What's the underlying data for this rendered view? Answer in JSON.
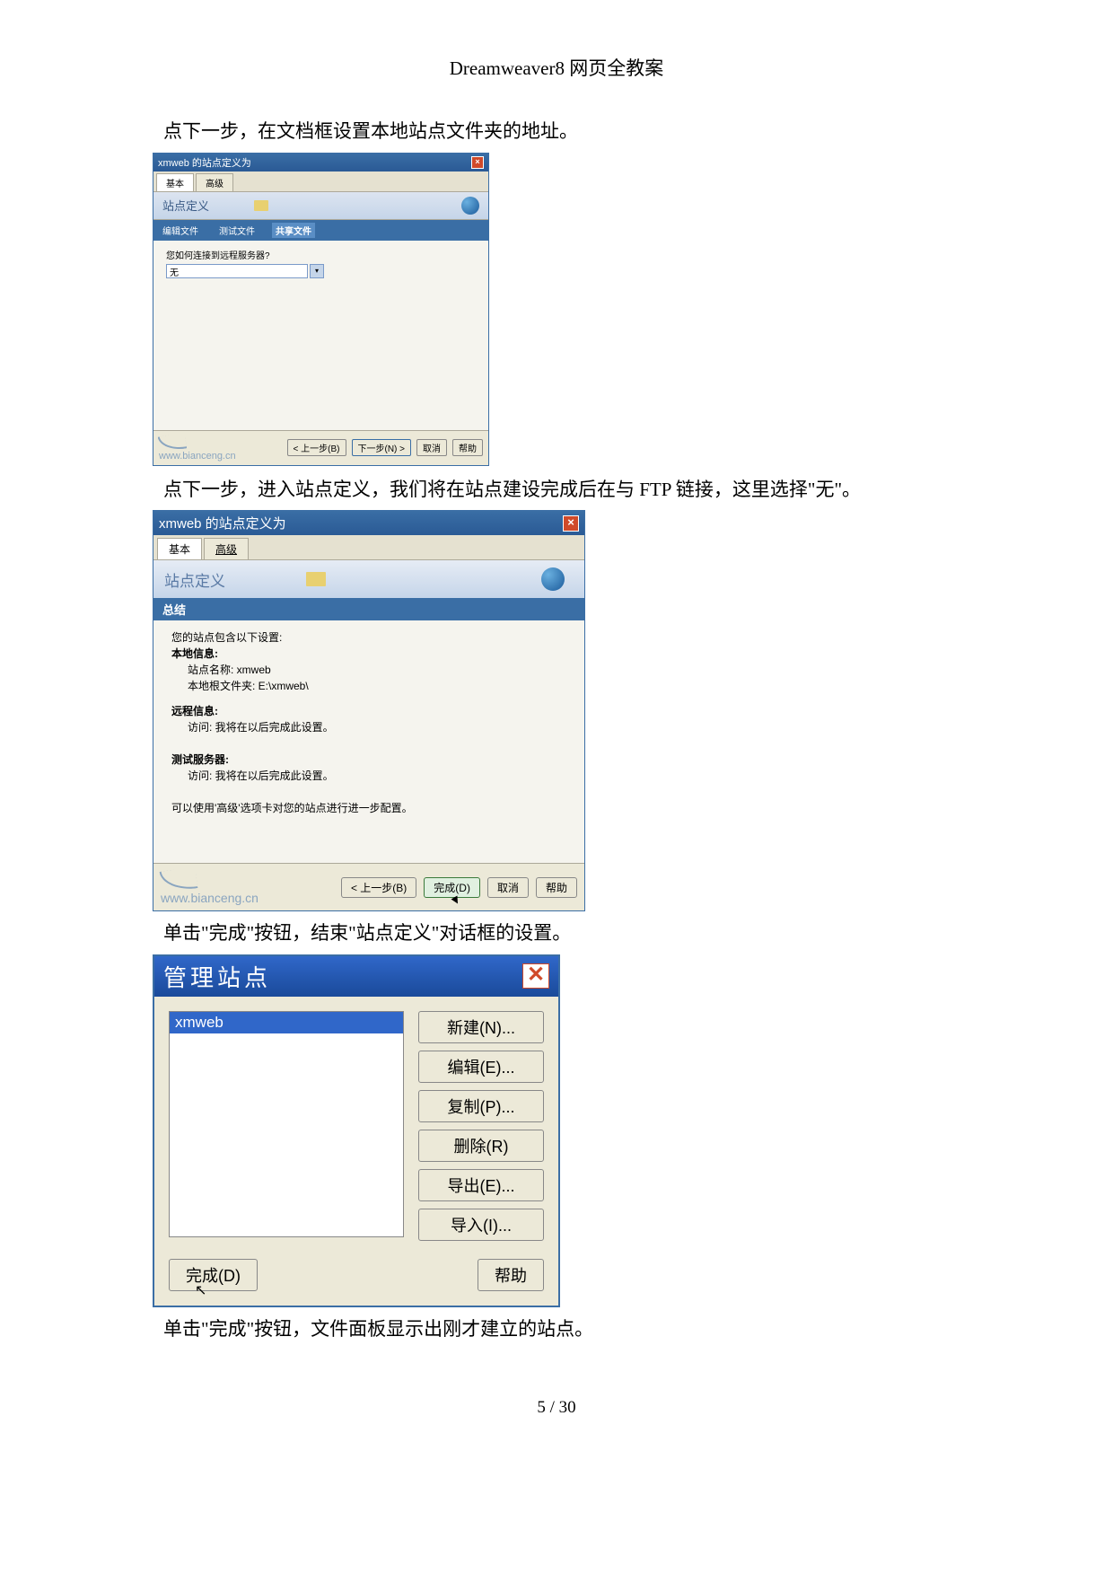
{
  "header": {
    "title": "Dreamweaver8 网页全教案"
  },
  "paragraphs": {
    "p1": "点下一步，在文档框设置本地站点文件夹的地址。",
    "p2": "点下一步，进入站点定义，我们将在站点建设完成后在与 FTP 链接，这里选择\"无\"。",
    "p3": "单击\"完成\"按钮，结束\"站点定义\"对话框的设置。",
    "p4": "单击\"完成\"按钮，文件面板显示出刚才建立的站点。"
  },
  "dialog1": {
    "title": "xmweb 的站点定义为",
    "tab_basic": "基本",
    "tab_adv": "高级",
    "heading": "站点定义",
    "subtab1": "编辑文件",
    "subtab2": "测试文件",
    "subtab3": "共享文件",
    "question": "您如何连接到远程服务器?",
    "select_value": "无",
    "watermark": "www.bianceng.cn",
    "btn_prev": "< 上一步(B)",
    "btn_next": "下一步(N) >",
    "btn_cancel": "取消",
    "btn_help": "帮助"
  },
  "dialog2": {
    "title": "xmweb 的站点定义为",
    "tab_basic": "基本",
    "tab_adv": "高级",
    "heading": "站点定义",
    "section": "总结",
    "intro": "您的站点包含以下设置:",
    "local_label": "本地信息:",
    "local_name": "站点名称: xmweb",
    "local_folder": "本地根文件夹: E:\\xmweb\\",
    "remote_label": "远程信息:",
    "remote_access": "访问: 我将在以后完成此设置。",
    "test_label": "测试服务器:",
    "test_access": "访问: 我将在以后完成此设置。",
    "tip": "可以使用'高级'选项卡对您的站点进行进一步配置。",
    "watermark": "www.bianceng.cn",
    "btn_prev": "< 上一步(B)",
    "btn_done": "完成(D)",
    "btn_cancel": "取消",
    "btn_help": "帮助"
  },
  "dialog3": {
    "title": "管理站点",
    "list_item": "xmweb",
    "btn_new": "新建(N)...",
    "btn_edit": "编辑(E)...",
    "btn_copy": "复制(P)...",
    "btn_delete": "删除(R)",
    "btn_export": "导出(E)...",
    "btn_import": "导入(I)...",
    "btn_done": "完成(D)",
    "btn_help": "帮助"
  },
  "footer": {
    "page_number": "5 / 30"
  }
}
